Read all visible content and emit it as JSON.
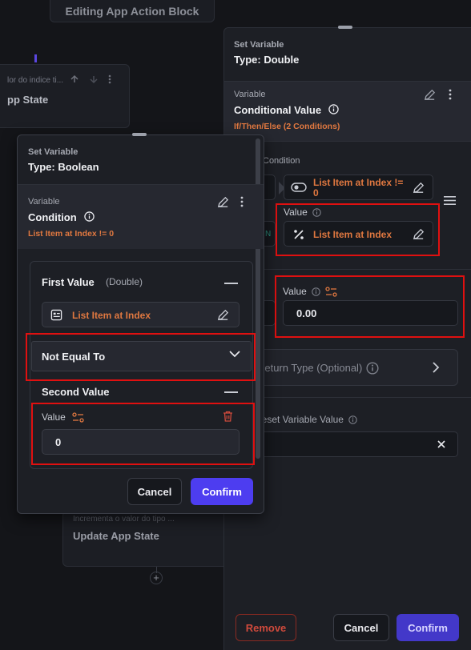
{
  "canvas": {
    "top_pill": "Editing App Action Block",
    "card1_sub": "lor do indice ti...",
    "card1_title": "pp State",
    "card2_sub": "Incrementa o valor do tipo ...",
    "card2_title": "Update App State",
    "plus": "+"
  },
  "right_panel": {
    "header_sub": "Set Variable",
    "header_title": "Type: Double",
    "variable_label": "Variable",
    "variable_name": "Conditional Value",
    "variable_subline": "If/Then/Else (2 Conditions)",
    "condition_label": "Condition",
    "condition_value": "List Item at Index  != 0",
    "value_label": "Value",
    "value_field": "List Item at Index",
    "value2_label": "Value",
    "value2_field": "0.00",
    "return_type": "Return Type (Optional)",
    "reset_label": "Reset Variable Value",
    "left_stub_text": "N",
    "remove": "Remove",
    "cancel": "Cancel",
    "confirm": "Confirm"
  },
  "left_panel": {
    "header_sub": "Set Variable",
    "header_title": "Type: Boolean",
    "variable_label": "Variable",
    "variable_name": "Condition",
    "variable_subline": "List Item at Index  !=  0",
    "first_value_label": "First Value",
    "first_value_type": "(Double)",
    "first_value_field": "List Item at Index",
    "operator": "Not Equal To",
    "second_value_label": "Second Value",
    "value_label": "Value",
    "value_field": "0",
    "cancel": "Cancel",
    "confirm": "Confirm"
  },
  "colors": {
    "accent": "#4d3df0",
    "orange_text": "#e07840",
    "highlight": "#e01010",
    "remove": "#d04a3c"
  }
}
